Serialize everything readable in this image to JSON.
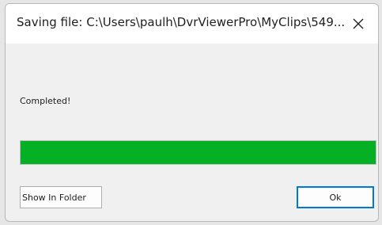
{
  "dialog": {
    "title": "Saving file: C:\\Users\\paulh\\DvrViewerPro\\MyClips\\549...",
    "status": "Completed!",
    "progress_percent": 100,
    "progress_color": "#06b025",
    "close_icon": "close-icon"
  },
  "buttons": {
    "show_in_folder": "Show In Folder",
    "ok": "Ok"
  }
}
